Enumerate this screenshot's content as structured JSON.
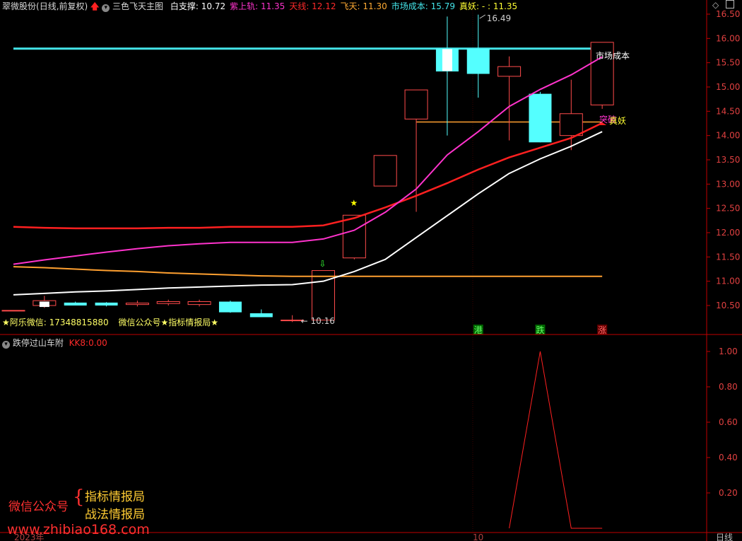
{
  "main_header": {
    "stock": "翠微股份",
    "mode": "(日线,前复权)",
    "indicator": "三色飞天主图",
    "fields": [
      {
        "label": "白支撑:",
        "value": "10.72",
        "color": "#ffffff"
      },
      {
        "label": "紫上轨:",
        "value": "11.35",
        "color": "#ff33cc"
      },
      {
        "label": "天线:",
        "value": "12.12",
        "color": "#ff2a2a"
      },
      {
        "label": "飞天:",
        "value": "11.30",
        "color": "#ffaa33"
      },
      {
        "label": "市场成本:",
        "value": "15.79",
        "color": "#44e5ea"
      },
      {
        "label": "真妖:",
        "value": "- : 11.35",
        "color": "#ffff33"
      }
    ]
  },
  "sub_header": {
    "indicator": "跌停过山车附",
    "field_label": "KK8:",
    "field_value": "0.00"
  },
  "main_right_axis": [
    "16.50",
    "16.00",
    "15.50",
    "15.00",
    "14.50",
    "14.00",
    "13.50",
    "13.00",
    "12.50",
    "12.00",
    "11.50",
    "11.00",
    "10.50"
  ],
  "sub_right_axis": [
    "1.00",
    "0.80",
    "0.60",
    "0.40",
    "0.20"
  ],
  "bottom_axis": {
    "left": "2023年",
    "mid": "10",
    "right": "日线"
  },
  "watermarks": {
    "contact": "★阿乐微信: 17348815880",
    "gzh": "微信公众号★指标情报局★",
    "left_label": "微信公众号",
    "line1": "指标情报局",
    "line2": "战法情报局",
    "site": "www.zhibiao168.com"
  },
  "annotations": {
    "high": "16.49",
    "low": "10.16",
    "market_cost": "市场成本",
    "breakout": "突破",
    "real_demon": "真妖",
    "tag_gang": "港",
    "tag_die": "跌",
    "tag_zhang": "涨"
  },
  "colors": {
    "up": "#ff4b4b",
    "down": "#54ffff",
    "bg": "#000000",
    "axis": "#c00000",
    "white_line": "#ffffff",
    "purple_line": "#ff33cc",
    "red_line": "#ff2020",
    "orange_line": "#ffa030",
    "cyan_line": "#44e5ea"
  },
  "chart_data": [
    {
      "type": "candlestick",
      "candles": [
        {
          "o": 10.4,
          "c": 10.4,
          "h": 10.4,
          "l": 10.4
        },
        {
          "o": 10.5,
          "c": 10.6,
          "h": 10.7,
          "l": 10.45
        },
        {
          "o": 10.56,
          "c": 10.5,
          "h": 10.58,
          "l": 10.5
        },
        {
          "o": 10.56,
          "c": 10.5,
          "h": 10.57,
          "l": 10.48
        },
        {
          "o": 10.52,
          "c": 10.55,
          "h": 10.6,
          "l": 10.48
        },
        {
          "o": 10.54,
          "c": 10.58,
          "h": 10.62,
          "l": 10.5
        },
        {
          "o": 10.52,
          "c": 10.58,
          "h": 10.62,
          "l": 10.48
        },
        {
          "o": 10.58,
          "c": 10.36,
          "h": 10.6,
          "l": 10.35
        },
        {
          "o": 10.34,
          "c": 10.26,
          "h": 10.42,
          "l": 10.26
        },
        {
          "o": 10.19,
          "c": 10.2,
          "h": 10.3,
          "l": 10.16
        },
        {
          "o": 10.2,
          "c": 11.22,
          "h": 11.22,
          "l": 10.2
        },
        {
          "o": 11.48,
          "c": 12.36,
          "h": 12.36,
          "l": 11.45
        },
        {
          "o": 12.96,
          "c": 13.59,
          "h": 13.59,
          "l": 12.96
        },
        {
          "o": 14.34,
          "c": 14.94,
          "h": 14.94,
          "l": 12.43
        },
        {
          "o": 15.79,
          "c": 15.32,
          "h": 16.45,
          "l": 14.0
        },
        {
          "o": 15.79,
          "c": 15.27,
          "h": 16.49,
          "l": 14.78
        },
        {
          "o": 15.22,
          "c": 15.42,
          "h": 15.63,
          "l": 13.9
        },
        {
          "o": 14.86,
          "c": 13.86,
          "h": 14.9,
          "l": 13.86
        },
        {
          "o": 14.0,
          "c": 14.45,
          "h": 15.15,
          "l": 13.7
        },
        {
          "o": 14.63,
          "c": 15.92,
          "h": 15.92,
          "l": 14.55
        }
      ],
      "lines": {
        "white_support": [
          10.72,
          10.75,
          10.78,
          10.8,
          10.83,
          10.86,
          10.88,
          10.9,
          10.92,
          10.93,
          11.0,
          11.2,
          11.45,
          11.9,
          12.35,
          12.8,
          13.22,
          13.52,
          13.78,
          14.08
        ],
        "purple_upper": [
          11.35,
          11.44,
          11.52,
          11.6,
          11.67,
          11.73,
          11.77,
          11.8,
          11.8,
          11.8,
          11.87,
          12.05,
          12.42,
          12.9,
          13.6,
          14.08,
          14.6,
          14.95,
          15.25,
          15.62
        ],
        "red_antenna": [
          12.12,
          12.1,
          12.09,
          12.09,
          12.09,
          12.1,
          12.1,
          12.12,
          12.12,
          12.12,
          12.15,
          12.3,
          12.52,
          12.76,
          13.02,
          13.3,
          13.55,
          13.75,
          13.95,
          14.26
        ],
        "orange_feitian": [
          11.3,
          11.28,
          11.25,
          11.22,
          11.2,
          11.17,
          11.15,
          11.13,
          11.11,
          11.1,
          11.1,
          11.1,
          11.1,
          11.1,
          11.1,
          11.1,
          11.1,
          11.1,
          11.1,
          11.1
        ],
        "cyan_market_cost": 15.79,
        "orange_level": 14.28
      },
      "ylim": [
        10.0,
        16.7
      ]
    },
    {
      "type": "line",
      "series": [
        {
          "values": [
            0,
            0,
            0,
            0,
            0,
            0,
            0,
            0,
            0,
            0,
            0,
            0,
            0,
            0,
            0,
            0,
            0,
            1,
            0,
            0
          ]
        }
      ],
      "ylim": [
        0,
        1.07
      ]
    }
  ]
}
